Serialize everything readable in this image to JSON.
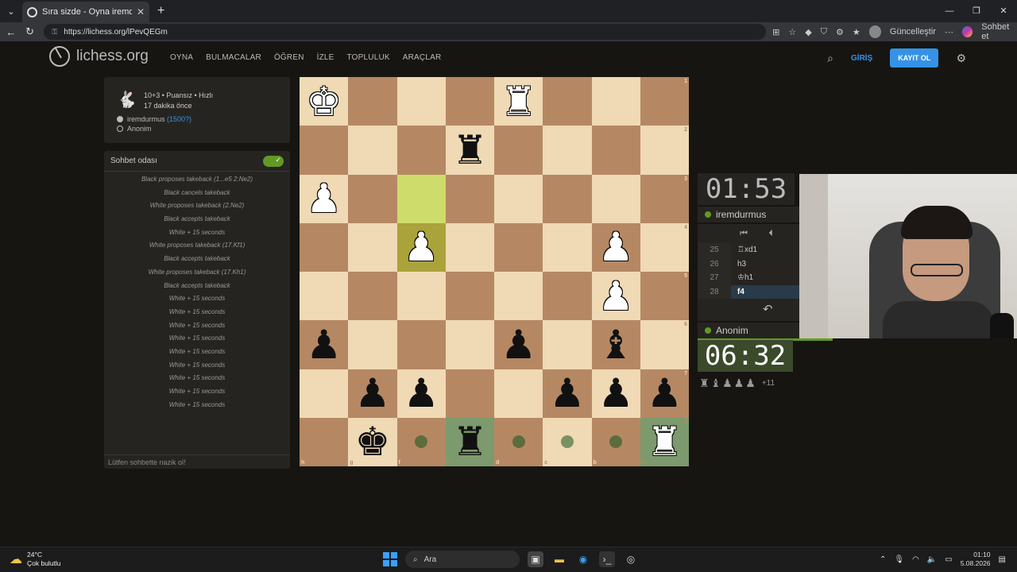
{
  "browser": {
    "tab_title": "Sıra sizde - Oyna iremdurmus • lic",
    "url": "https://lichess.org/lPevQEGm",
    "toolbar_update": "Güncelleştir",
    "toolbar_chat": "Sohbet et"
  },
  "header": {
    "logo": "lichess.org",
    "menu": [
      "OYNA",
      "BULMACALAR",
      "ÖĞREN",
      "İZLE",
      "TOPLULUK",
      "ARAÇLAR"
    ],
    "login": "GİRİŞ",
    "signup": "KAYIT OL"
  },
  "game_info": {
    "mode": "10+3 • Puansız • Hızlı",
    "time_ago": "17 dakika önce",
    "white_player": "iremdurmus",
    "white_rating": "(1500?)",
    "black_player": "Anonim"
  },
  "chat": {
    "title": "Sohbet odası",
    "messages": [
      "Black proposes takeback (1...e5 2.Ne2)",
      "Black cancels takeback",
      "White proposes takeback (2.Ne2)",
      "Black accepts takeback",
      "White + 15 seconds",
      "White proposes takeback (17.Kf1)",
      "Black accepts takeback",
      "White proposes takeback (17.Kh1)",
      "Black accepts takeback",
      "White + 15 seconds",
      "White + 15 seconds",
      "White + 15 seconds",
      "White + 15 seconds",
      "White + 15 seconds",
      "White + 15 seconds",
      "White + 15 seconds",
      "White + 15 seconds",
      "White + 15 seconds"
    ],
    "placeholder": "Lütfen sohbette nazik ol!"
  },
  "board": {
    "orientation": "black",
    "files_bottom": [
      "h",
      "g",
      "f",
      "e",
      "d",
      "c",
      "b",
      "a"
    ],
    "ranks_right": [
      "1",
      "2",
      "3",
      "4",
      "5",
      "6",
      "7",
      "8"
    ],
    "rows": [
      [
        "K",
        "",
        "",
        "",
        "R",
        "",
        "",
        ""
      ],
      [
        "",
        "",
        "",
        "r",
        "",
        "",
        "",
        ""
      ],
      [
        "P",
        "",
        "",
        "",
        "",
        "",
        "",
        ""
      ],
      [
        "",
        "",
        "P",
        "",
        "",
        "",
        "P",
        ""
      ],
      [
        "",
        "",
        "",
        "",
        "",
        "",
        "P",
        ""
      ],
      [
        "p",
        "",
        "",
        "",
        "p",
        "",
        "b",
        ""
      ],
      [
        "",
        "p",
        "p",
        "",
        "",
        "p",
        "p",
        "p"
      ],
      [
        "",
        "k",
        "",
        "r",
        "",
        "",
        "",
        "R"
      ]
    ],
    "last_move_squares": [
      "f3",
      "f4"
    ],
    "selected_square": "e8",
    "move_dots": [
      "f8",
      "d8",
      "c8",
      "b8"
    ],
    "highlight_square": "a8"
  },
  "clocks": {
    "top": "01:53",
    "bottom": "06:32"
  },
  "players": {
    "top": "iremdurmus",
    "bottom": "Anonim"
  },
  "moves": [
    {
      "num": "25",
      "move": "♖xd1"
    },
    {
      "num": "26",
      "move": "h3"
    },
    {
      "num": "27",
      "move": "♔h1"
    },
    {
      "num": "28",
      "move": "f4"
    }
  ],
  "material": {
    "pieces": [
      "♜",
      "♝",
      "♟",
      "♟",
      "♟"
    ],
    "diff": "+11"
  },
  "taskbar": {
    "temp": "24°C",
    "weather": "Çok bulutlu",
    "search": "Ara",
    "time": "01:10",
    "date": "5.08.2026"
  }
}
